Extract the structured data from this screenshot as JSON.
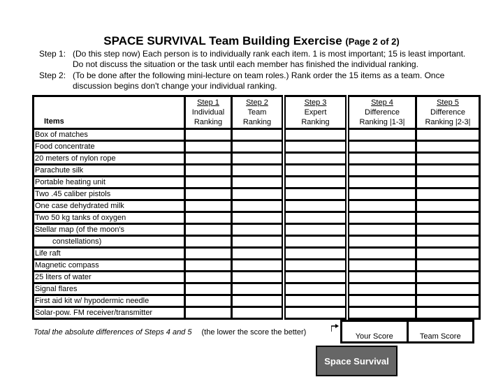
{
  "title": {
    "main": "SPACE SURVIVAL Team Building Exercise",
    "page": "(Page 2 of 2)"
  },
  "instructions": [
    {
      "label": "Step 1:",
      "line1": "(Do this step now) Each person is to individually rank each item.  1 is most important;  15 is least important.",
      "line2": "Do not discuss the situation or the task until each member has finished the individual ranking."
    },
    {
      "label": "Step 2:",
      "line1": "(To be done after the following mini-lecture on team roles.) Rank order the 15 items as a team.  Once",
      "line2": "discussion begins don't change your individual ranking."
    }
  ],
  "table": {
    "items_header": "Items",
    "columns": [
      {
        "step": "Step 1",
        "line1": "Individual",
        "line2": "Ranking"
      },
      {
        "step": "Step 2",
        "line1": "Team",
        "line2": "Ranking"
      },
      {
        "step": "Step 3",
        "line1": "Expert",
        "line2": "Ranking"
      },
      {
        "step": "Step 4",
        "line1": "Difference",
        "line2": "Ranking |1-3|"
      },
      {
        "step": "Step 5",
        "line1": "Difference",
        "line2": "Ranking |2-3|"
      }
    ],
    "items": [
      "Box of matches",
      "Food concentrate",
      "20 meters of nylon rope",
      "Parachute silk",
      "Portable heating unit",
      "Two .45 caliber pistols",
      "One case dehydrated milk",
      "Two 50 kg tanks of oxygen",
      "Stellar map (of the moon's",
      "constellations)",
      "Life raft",
      "Magnetic compass",
      "25 liters of water",
      "Signal flares",
      "First aid kit w/ hypodermic needle",
      "Solar-pow. FM receiver/transmitter"
    ]
  },
  "footer": {
    "total_text": "Total the absolute differences of Steps 4 and 5",
    "note": "(the lower the score the better)",
    "your_score_label": "Your Score",
    "team_score_label": "Team Score"
  },
  "brand_label": "Space Survival"
}
